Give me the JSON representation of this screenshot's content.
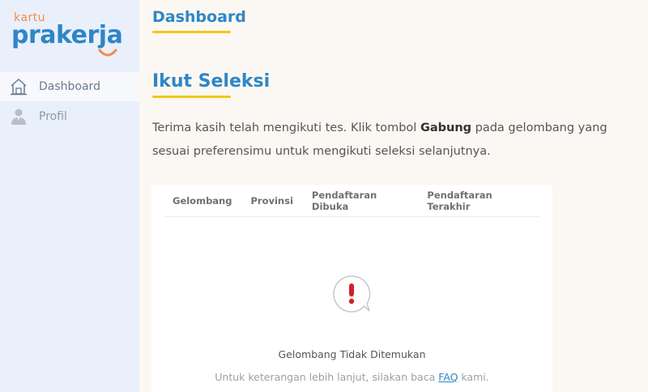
{
  "logo": {
    "kartu": "kartu",
    "prakerja": "prakerja"
  },
  "sidebar": {
    "items": [
      {
        "label": "Dashboard",
        "icon": "home-icon",
        "active": true
      },
      {
        "label": "Profil",
        "icon": "user-icon",
        "active": false
      }
    ]
  },
  "header": {
    "title": "Dashboard"
  },
  "section": {
    "title": "Ikut Seleksi",
    "desc_pre": "Terima kasih telah mengikuti tes. Klik tombol ",
    "desc_bold": "Gabung",
    "desc_post": " pada gelombang yang sesuai preferensimu untuk mengikuti seleksi selanjutnya."
  },
  "table": {
    "columns": [
      "Gelombang",
      "Provinsi",
      "Pendaftaran Dibuka",
      "Pendaftaran Terakhir"
    ]
  },
  "empty": {
    "icon": "alert-bubble-icon",
    "title": "Gelombang Tidak Ditemukan",
    "sub_pre": "Untuk keterangan lebih lanjut, silakan baca ",
    "sub_link": "FAQ",
    "sub_post": " kami."
  },
  "colors": {
    "brand_blue": "#2f86c6",
    "accent_yellow": "#f5c518",
    "logo_orange": "#f28c4a",
    "alert_red": "#d0202b"
  }
}
